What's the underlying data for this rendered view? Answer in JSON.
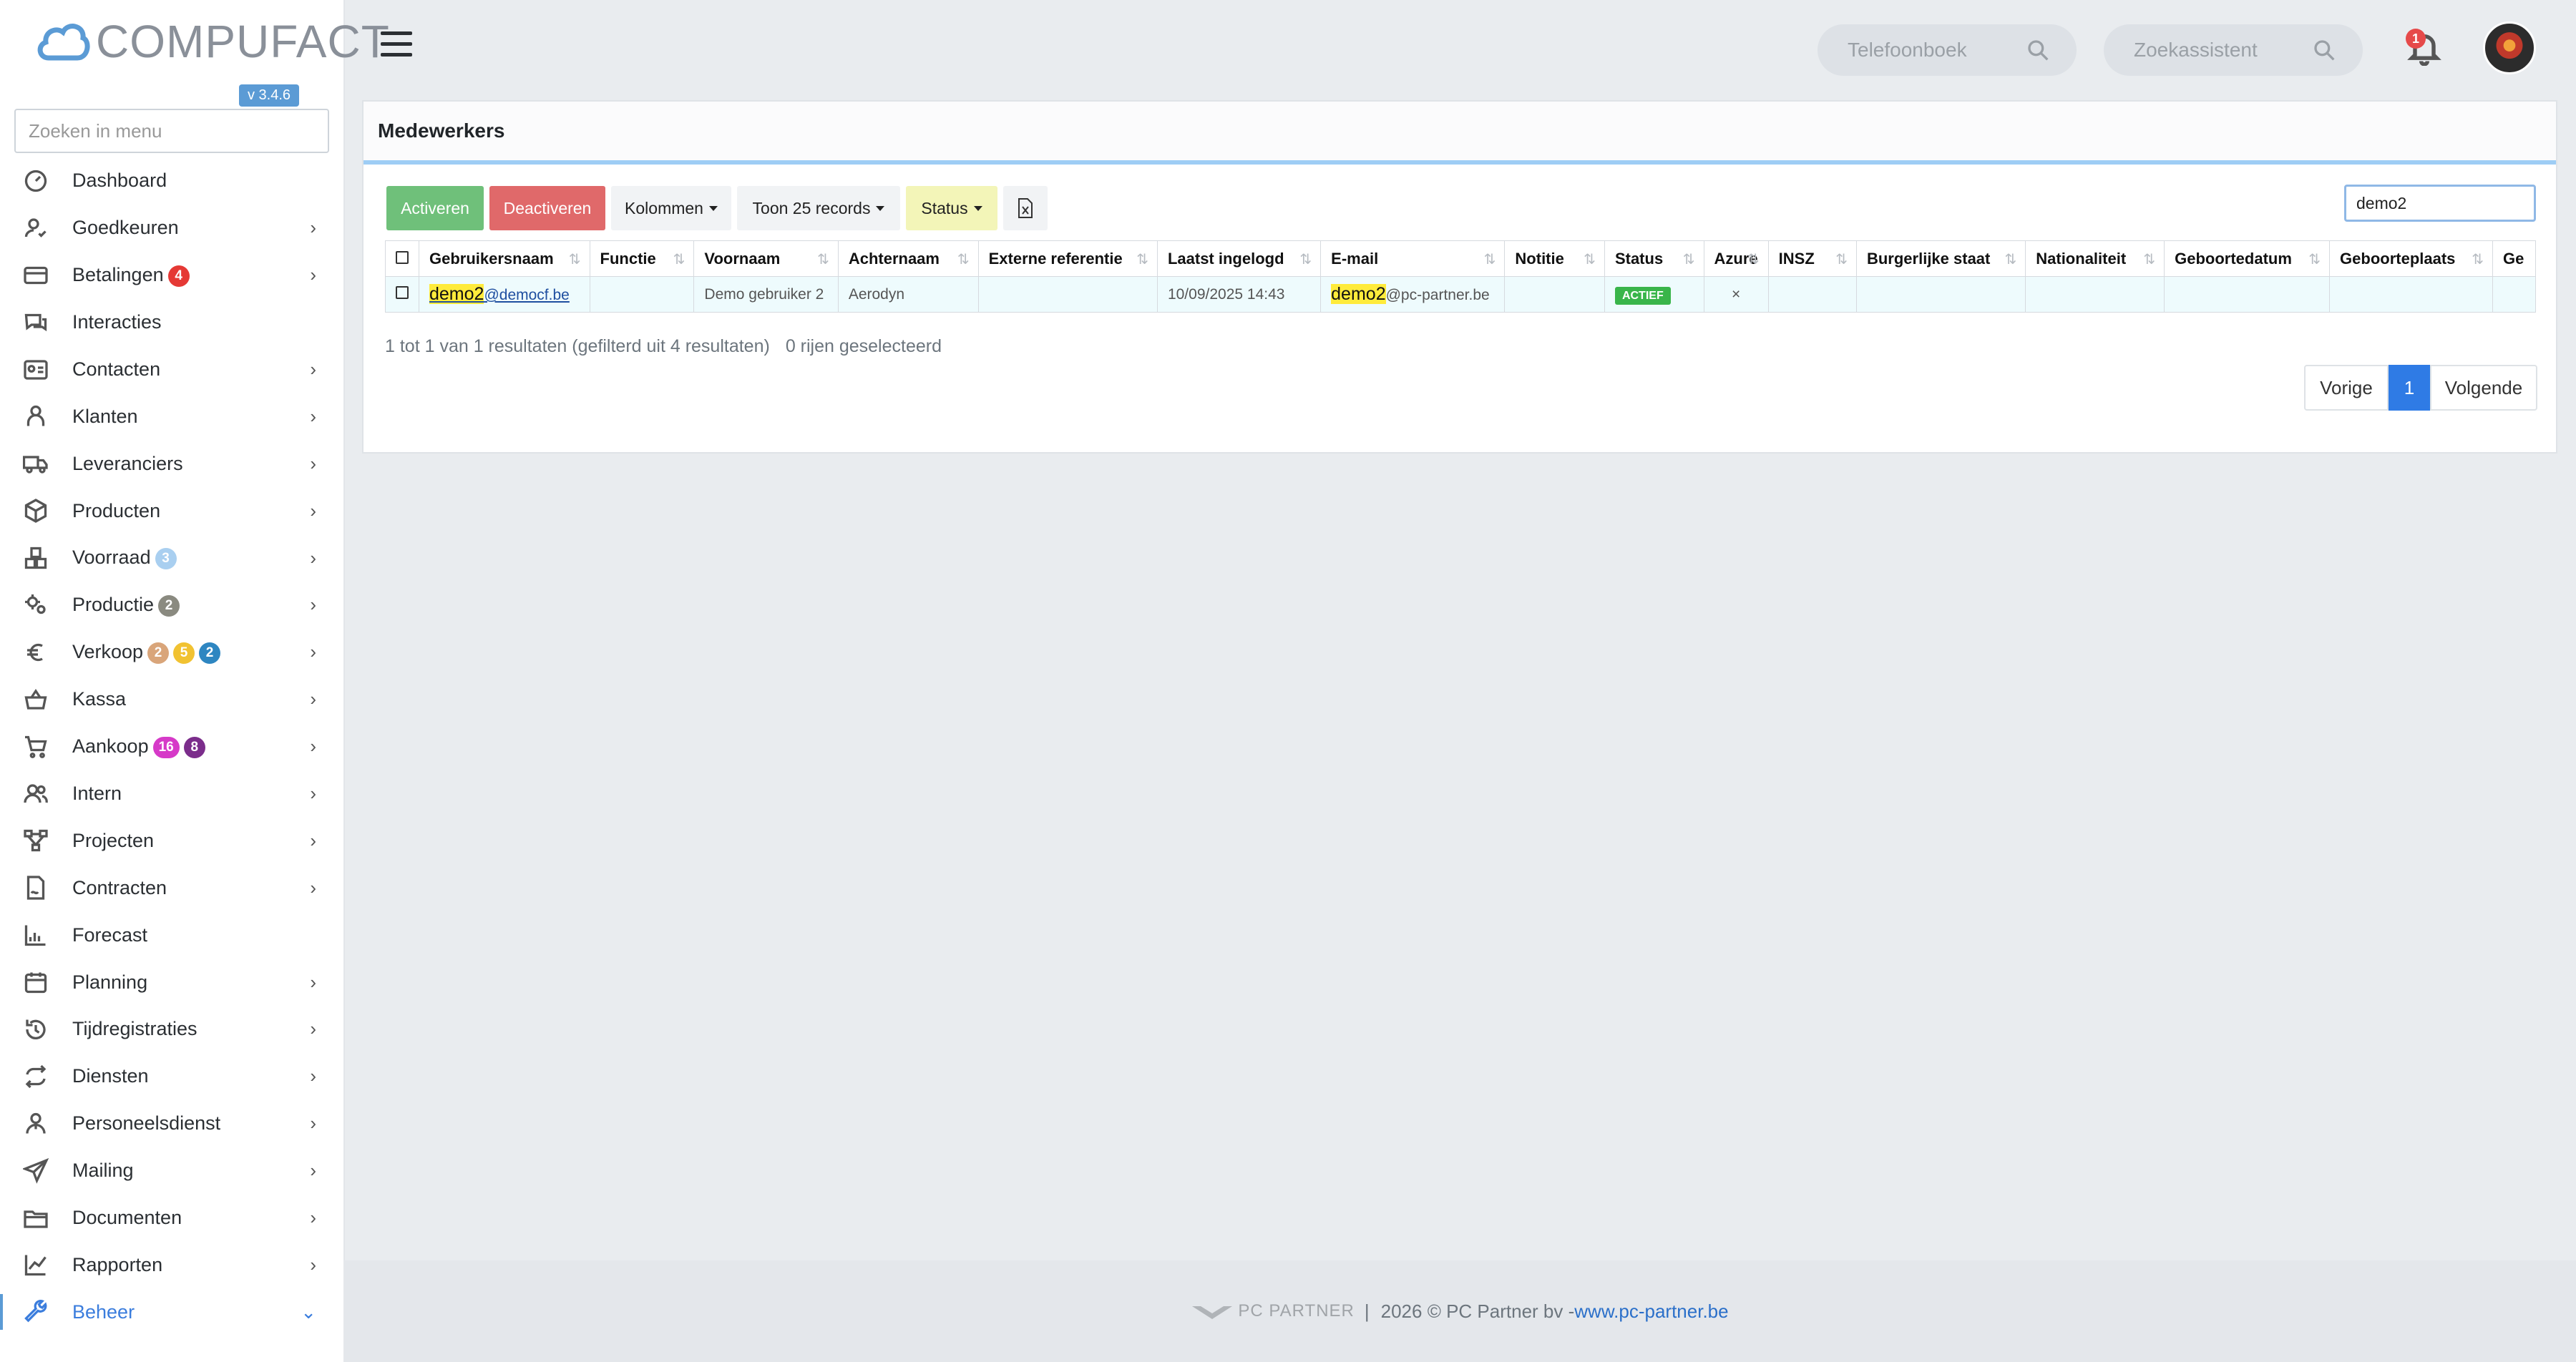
{
  "app": {
    "logo_text": "COMPUFACT",
    "version": "v 3.4.6"
  },
  "sidebar": {
    "search_placeholder": "Zoeken in menu",
    "items": [
      {
        "label": "Dashboard",
        "icon": "dashboard-icon",
        "chevron": false
      },
      {
        "label": "Goedkeuren",
        "icon": "user-check-icon",
        "chevron": true
      },
      {
        "label": "Betalingen",
        "icon": "credit-card-icon",
        "chevron": true,
        "badges": [
          {
            "text": "4",
            "color": "#e53935"
          }
        ]
      },
      {
        "label": "Interacties",
        "icon": "chat-icon",
        "chevron": false
      },
      {
        "label": "Contacten",
        "icon": "contact-card-icon",
        "chevron": true
      },
      {
        "label": "Klanten",
        "icon": "customer-icon",
        "chevron": true
      },
      {
        "label": "Leveranciers",
        "icon": "truck-icon",
        "chevron": true
      },
      {
        "label": "Producten",
        "icon": "box-icon",
        "chevron": true
      },
      {
        "label": "Voorraad",
        "icon": "boxes-icon",
        "chevron": true,
        "badges": [
          {
            "text": "3",
            "color": "#a9cff0"
          }
        ]
      },
      {
        "label": "Productie",
        "icon": "gears-icon",
        "chevron": true,
        "badges": [
          {
            "text": "2",
            "color": "#8a8a80"
          }
        ]
      },
      {
        "label": "Verkoop",
        "icon": "euro-icon",
        "chevron": true,
        "badges": [
          {
            "text": "2",
            "color": "#d9a57a"
          },
          {
            "text": "5",
            "color": "#f1c232"
          },
          {
            "text": "2",
            "color": "#2e86c1"
          }
        ]
      },
      {
        "label": "Kassa",
        "icon": "basket-icon",
        "chevron": true
      },
      {
        "label": "Aankoop",
        "icon": "cart-icon",
        "chevron": true,
        "badges": [
          {
            "text": "16",
            "color": "#d63ac8"
          },
          {
            "text": "8",
            "color": "#7b2d8b"
          }
        ]
      },
      {
        "label": "Intern",
        "icon": "users-icon",
        "chevron": true
      },
      {
        "label": "Projecten",
        "icon": "project-icon",
        "chevron": true
      },
      {
        "label": "Contracten",
        "icon": "contract-icon",
        "chevron": true
      },
      {
        "label": "Forecast",
        "icon": "forecast-icon",
        "chevron": false
      },
      {
        "label": "Planning",
        "icon": "calendar-icon",
        "chevron": true
      },
      {
        "label": "Tijdregistraties",
        "icon": "history-icon",
        "chevron": true
      },
      {
        "label": "Diensten",
        "icon": "repeat-icon",
        "chevron": true
      },
      {
        "label": "Personeelsdienst",
        "icon": "staff-icon",
        "chevron": true
      },
      {
        "label": "Mailing",
        "icon": "paper-plane-icon",
        "chevron": true
      },
      {
        "label": "Documenten",
        "icon": "folder-icon",
        "chevron": true
      },
      {
        "label": "Rapporten",
        "icon": "line-chart-icon",
        "chevron": true
      },
      {
        "label": "Beheer",
        "icon": "wrench-icon",
        "chevron": true,
        "active": true
      }
    ]
  },
  "topbar": {
    "phonebook_placeholder": "Telefoonboek",
    "assistant_placeholder": "Zoekassistent",
    "notification_count": "1"
  },
  "card": {
    "title": "Medewerkers",
    "buttons": {
      "activate": "Activeren",
      "deactivate": "Deactiveren",
      "columns": "Kolommen",
      "show_records": "Toon 25 records",
      "status": "Status"
    },
    "search_value": "demo2",
    "columns": [
      "Gebruikersnaam",
      "Functie",
      "Voornaam",
      "Achternaam",
      "Externe referentie",
      "Laatst ingelogd",
      "E-mail",
      "Notitie",
      "Status",
      "Azure",
      "INSZ",
      "Burgerlijke staat",
      "Nationaliteit",
      "Geboortedatum",
      "Geboorteplaats",
      "Ge"
    ],
    "rows": [
      {
        "username_match": "demo2",
        "username_rest": "@democf.be",
        "functie": "",
        "voornaam": "Demo gebruiker 2",
        "achternaam": "Aerodyn",
        "externe_referentie": "",
        "laatst_ingelogd": "10/09/2025 14:43",
        "email_match": "demo2",
        "email_rest": "@pc-partner.be",
        "notitie": "",
        "status": "ACTIEF",
        "azure": "×"
      }
    ],
    "summary": "1 tot 1 van 1 resultaten (gefilterd uit 4 resultaten)",
    "selected": "0 rijen geselecteerd",
    "pagination": {
      "prev": "Vorige",
      "current": "1",
      "next": "Volgende"
    }
  },
  "footer": {
    "brand": "PC PARTNER",
    "separator": "|",
    "copyright": "2026 © PC Partner bv - ",
    "link": "www.pc-partner.be"
  },
  "colors": {
    "accent": "#3b7ddd",
    "activate_btn": "#6fc07a",
    "deactivate_btn": "#e0696a",
    "status_btn": "#f3f5b8",
    "status_active": "#39b54a",
    "highlight": "#ffeb3b"
  }
}
